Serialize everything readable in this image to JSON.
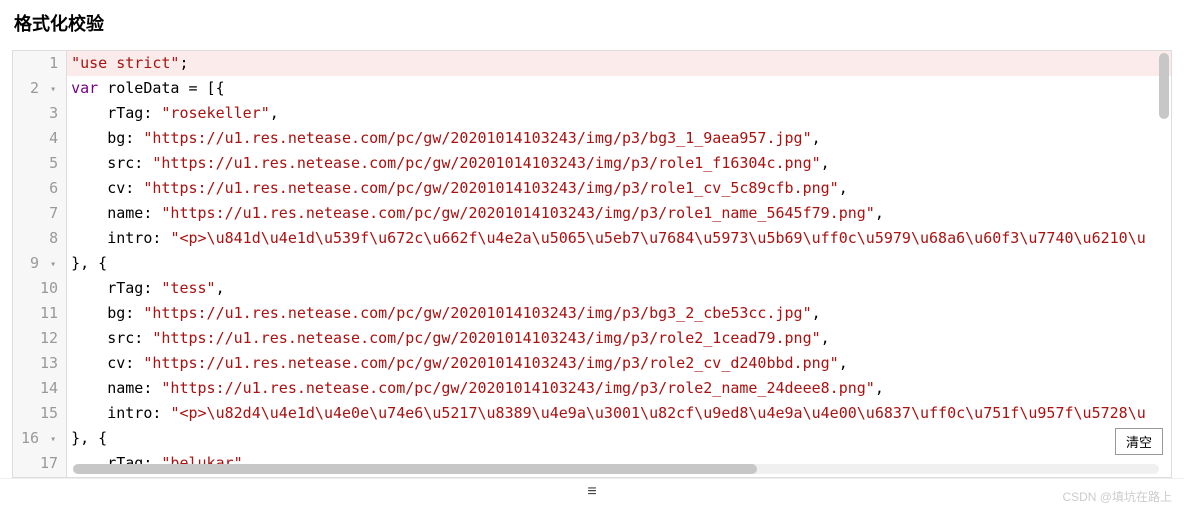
{
  "title": "格式化校验",
  "clear_btn": "清空",
  "watermark": "CSDN @填坑在路上",
  "drag_icon": "≡",
  "fold_marker": "▾",
  "lines": [
    {
      "n": 1,
      "hl": true,
      "fold": "",
      "segs": [
        [
          "str",
          "\"use strict\""
        ],
        [
          "plain",
          ";"
        ]
      ]
    },
    {
      "n": 2,
      "hl": false,
      "fold": "▾",
      "segs": [
        [
          "kw",
          "var"
        ],
        [
          "plain",
          " roleData "
        ],
        [
          "plain",
          "= [{"
        ]
      ]
    },
    {
      "n": 3,
      "hl": false,
      "fold": "",
      "segs": [
        [
          "plain",
          "    rTag: "
        ],
        [
          "str",
          "\"rosekeller\""
        ],
        [
          "plain",
          ","
        ]
      ]
    },
    {
      "n": 4,
      "hl": false,
      "fold": "",
      "segs": [
        [
          "plain",
          "    bg: "
        ],
        [
          "str",
          "\"https://u1.res.netease.com/pc/gw/20201014103243/img/p3/bg3_1_9aea957.jpg\""
        ],
        [
          "plain",
          ","
        ]
      ]
    },
    {
      "n": 5,
      "hl": false,
      "fold": "",
      "segs": [
        [
          "plain",
          "    src: "
        ],
        [
          "str",
          "\"https://u1.res.netease.com/pc/gw/20201014103243/img/p3/role1_f16304c.png\""
        ],
        [
          "plain",
          ","
        ]
      ]
    },
    {
      "n": 6,
      "hl": false,
      "fold": "",
      "segs": [
        [
          "plain",
          "    cv: "
        ],
        [
          "str",
          "\"https://u1.res.netease.com/pc/gw/20201014103243/img/p3/role1_cv_5c89cfb.png\""
        ],
        [
          "plain",
          ","
        ]
      ]
    },
    {
      "n": 7,
      "hl": false,
      "fold": "",
      "segs": [
        [
          "plain",
          "    name: "
        ],
        [
          "str",
          "\"https://u1.res.netease.com/pc/gw/20201014103243/img/p3/role1_name_5645f79.png\""
        ],
        [
          "plain",
          ","
        ]
      ]
    },
    {
      "n": 8,
      "hl": false,
      "fold": "",
      "segs": [
        [
          "plain",
          "    intro: "
        ],
        [
          "str",
          "\"<p>\\u841d\\u4e1d\\u539f\\u672c\\u662f\\u4e2a\\u5065\\u5eb7\\u7684\\u5973\\u5b69\\uff0c\\u5979\\u68a6\\u60f3\\u7740\\u6210\\u"
        ]
      ]
    },
    {
      "n": 9,
      "hl": false,
      "fold": "▾",
      "segs": [
        [
          "plain",
          "}, {"
        ]
      ]
    },
    {
      "n": 10,
      "hl": false,
      "fold": "",
      "segs": [
        [
          "plain",
          "    rTag: "
        ],
        [
          "str",
          "\"tess\""
        ],
        [
          "plain",
          ","
        ]
      ]
    },
    {
      "n": 11,
      "hl": false,
      "fold": "",
      "segs": [
        [
          "plain",
          "    bg: "
        ],
        [
          "str",
          "\"https://u1.res.netease.com/pc/gw/20201014103243/img/p3/bg3_2_cbe53cc.jpg\""
        ],
        [
          "plain",
          ","
        ]
      ]
    },
    {
      "n": 12,
      "hl": false,
      "fold": "",
      "segs": [
        [
          "plain",
          "    src: "
        ],
        [
          "str",
          "\"https://u1.res.netease.com/pc/gw/20201014103243/img/p3/role2_1cead79.png\""
        ],
        [
          "plain",
          ","
        ]
      ]
    },
    {
      "n": 13,
      "hl": false,
      "fold": "",
      "segs": [
        [
          "plain",
          "    cv: "
        ],
        [
          "str",
          "\"https://u1.res.netease.com/pc/gw/20201014103243/img/p3/role2_cv_d240bbd.png\""
        ],
        [
          "plain",
          ","
        ]
      ]
    },
    {
      "n": 14,
      "hl": false,
      "fold": "",
      "segs": [
        [
          "plain",
          "    name: "
        ],
        [
          "str",
          "\"https://u1.res.netease.com/pc/gw/20201014103243/img/p3/role2_name_24deee8.png\""
        ],
        [
          "plain",
          ","
        ]
      ]
    },
    {
      "n": 15,
      "hl": false,
      "fold": "",
      "segs": [
        [
          "plain",
          "    intro: "
        ],
        [
          "str",
          "\"<p>\\u82d4\\u4e1d\\u4e0e\\u74e6\\u5217\\u8389\\u4e9a\\u3001\\u82cf\\u9ed8\\u4e9a\\u4e00\\u6837\\uff0c\\u751f\\u957f\\u5728\\u"
        ]
      ]
    },
    {
      "n": 16,
      "hl": false,
      "fold": "▾",
      "segs": [
        [
          "plain",
          "}, {"
        ]
      ]
    },
    {
      "n": 17,
      "hl": false,
      "fold": "",
      "segs": [
        [
          "plain",
          "    rTag: "
        ],
        [
          "str",
          "\"belukar\""
        ]
      ]
    }
  ]
}
